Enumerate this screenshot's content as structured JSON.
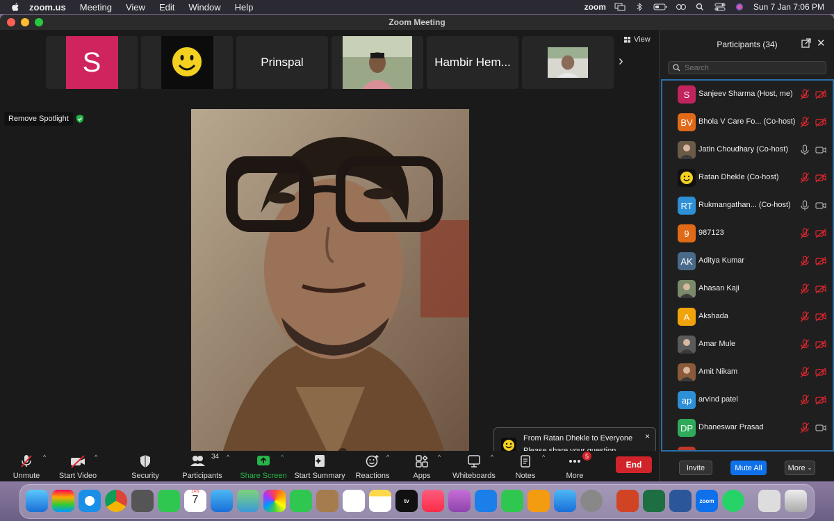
{
  "menubar": {
    "app": "zoom.us",
    "items": [
      "Meeting",
      "View",
      "Edit",
      "Window",
      "Help"
    ],
    "right_label": "zoom",
    "datetime": "Sun 7 Jan  7:06 PM"
  },
  "window": {
    "title": "Zoom Meeting"
  },
  "strip": {
    "tiles": [
      {
        "type": "avatar",
        "letter": "S",
        "color": "#d0245f"
      },
      {
        "type": "smiley"
      },
      {
        "type": "name",
        "name": "Prinspal"
      },
      {
        "type": "photo"
      },
      {
        "type": "name",
        "name": "Hambir Hem..."
      },
      {
        "type": "photo"
      }
    ],
    "view_label": "View"
  },
  "spotlight": {
    "label": "Remove Spotlight"
  },
  "toast": {
    "from": "From Ratan Dhekle to Everyone",
    "message": "Please share your question",
    "close": "×"
  },
  "toolbar": {
    "unmute": "Unmute",
    "start_video": "Start Video",
    "security": "Security",
    "participants": "Participants",
    "participants_count": "34",
    "share_screen": "Share Screen",
    "start_summary": "Start Summary",
    "reactions": "Reactions",
    "apps": "Apps",
    "whiteboards": "Whiteboards",
    "notes": "Notes",
    "more": "More",
    "more_badge": "5",
    "end": "End"
  },
  "panel": {
    "title": "Participants (34)",
    "search_placeholder": "Search",
    "participants": [
      {
        "initials": "S",
        "color": "#c1245c",
        "name": "Sanjeev Sharma (Host, me)",
        "mic": "muted",
        "cam": "off"
      },
      {
        "initials": "BV",
        "color": "#e06a17",
        "name": "Bhola V Care Fo... (Co-host)",
        "mic": "muted",
        "cam": "off"
      },
      {
        "initials": "",
        "color": "#6b5a48",
        "name": "Jatin Choudhary (Co-host)",
        "mic": "on",
        "cam": "on"
      },
      {
        "initials": "",
        "color": "#111111",
        "name": "Ratan Dhekle (Co-host)",
        "mic": "muted",
        "cam": "off"
      },
      {
        "initials": "RT",
        "color": "#2d8fd6",
        "name": "Rukmangathan...  (Co-host)",
        "mic": "on",
        "cam": "on"
      },
      {
        "initials": "9",
        "color": "#e06a17",
        "name": "987123",
        "mic": "muted",
        "cam": "off"
      },
      {
        "initials": "AK",
        "color": "#4a6a8a",
        "name": "Aditya Kumar",
        "mic": "muted",
        "cam": "off"
      },
      {
        "initials": "",
        "color": "#7a8a6a",
        "name": "Ahasan Kaji",
        "mic": "muted",
        "cam": "off"
      },
      {
        "initials": "A",
        "color": "#f0a30a",
        "name": "Akshada",
        "mic": "muted",
        "cam": "off"
      },
      {
        "initials": "",
        "color": "#5a5a5a",
        "name": "Amar Mule",
        "mic": "muted",
        "cam": "off"
      },
      {
        "initials": "",
        "color": "#8a5a3a",
        "name": "Amit Nikam",
        "mic": "muted",
        "cam": "off"
      },
      {
        "initials": "ap",
        "color": "#2d8fd6",
        "name": "arvind patel",
        "mic": "muted",
        "cam": "off"
      },
      {
        "initials": "DP",
        "color": "#2eaa5a",
        "name": "Dhaneswar Prasad",
        "mic": "muted",
        "cam": "on"
      },
      {
        "initials": "",
        "color": "#c0392b",
        "name": "",
        "mic": "",
        "cam": ""
      }
    ],
    "invite": "Invite",
    "mute_all": "Mute All",
    "more": "More"
  },
  "dock": {
    "calendar_month": "JAN",
    "calendar_day": "7",
    "tv_label": "tv",
    "zoom_label": "zoom"
  }
}
